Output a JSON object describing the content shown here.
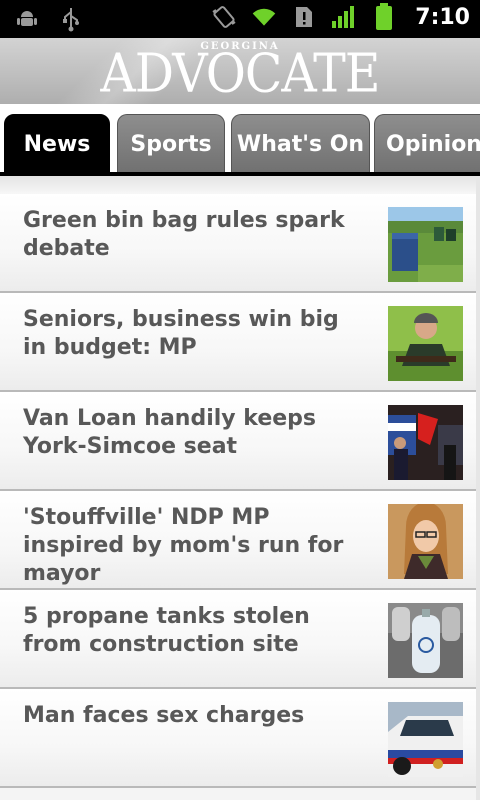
{
  "status_bar": {
    "time": "7:10",
    "icons": [
      "android-debug-icon",
      "usb-icon",
      "vibrate-icon",
      "wifi-icon",
      "sim-alert-icon",
      "signal-icon",
      "battery-icon"
    ]
  },
  "header": {
    "logo_small": "GEORGINA",
    "logo_main": "ADVOCATE"
  },
  "tabs": [
    {
      "label": "News",
      "active": true
    },
    {
      "label": "Sports",
      "active": false
    },
    {
      "label": "What's On",
      "active": false
    },
    {
      "label": "Opinion",
      "active": false
    }
  ],
  "articles": [
    {
      "headline": "Green bin bag rules spark debate",
      "thumb": "green-bins-photo"
    },
    {
      "headline": "Seniors, business win big in budget: MP",
      "thumb": "mp-portrait-photo"
    },
    {
      "headline": "Van Loan handily keeps York-Simcoe seat",
      "thumb": "election-night-photo"
    },
    {
      "headline": "'Stouffville' NDP MP inspired by mom's run for mayor",
      "thumb": "woman-portrait-photo"
    },
    {
      "headline": "5 propane tanks stolen from construction site",
      "thumb": "propane-tank-photo"
    },
    {
      "headline": "Man faces sex charges",
      "thumb": "police-car-photo"
    }
  ],
  "colors": {
    "status_bar_bg": "#000000",
    "active_tab": "#000000",
    "inactive_tab": "#7d7d7d",
    "headline_text": "#585858"
  }
}
